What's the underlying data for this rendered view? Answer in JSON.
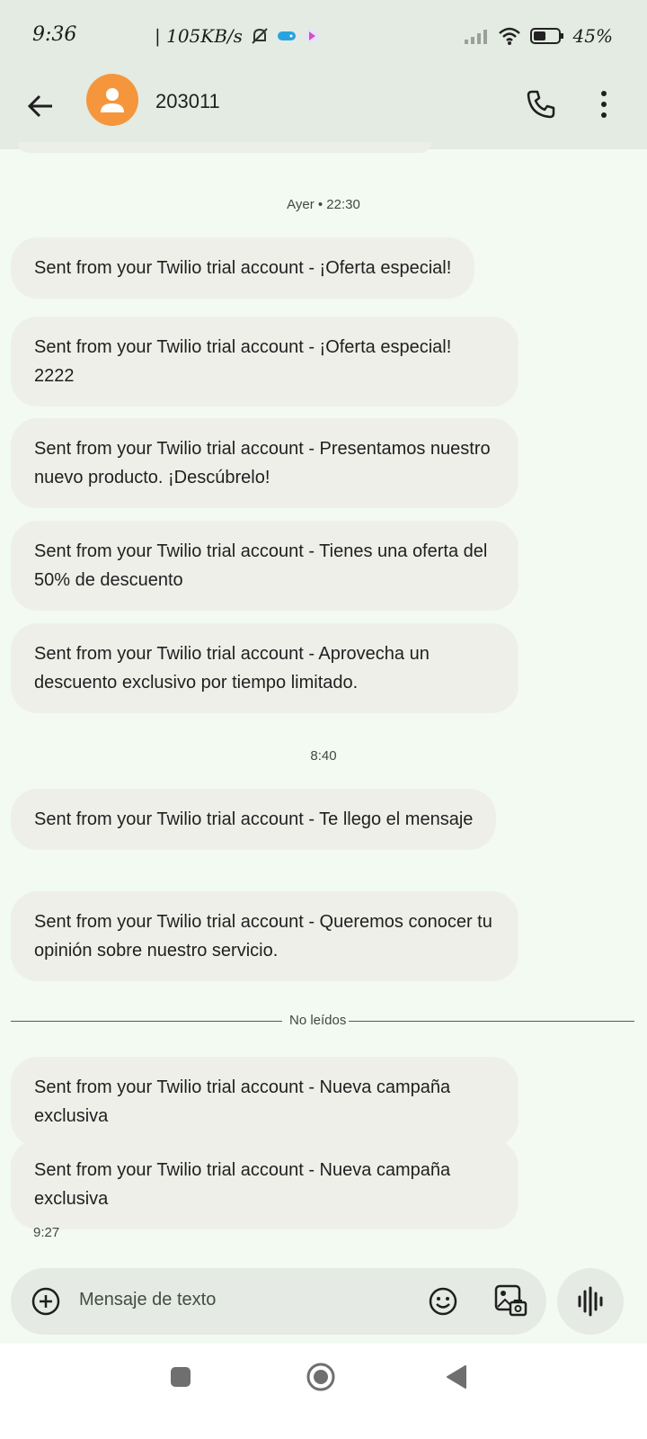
{
  "status_bar": {
    "time": "9:36",
    "network_speed": "| 105KB/s",
    "battery": "45%"
  },
  "header": {
    "contact_name": "203011"
  },
  "conversation": {
    "timestamp_1": "Ayer • 22:30",
    "messages_group_1": [
      "Sent from your Twilio trial account - ¡Oferta especial!",
      "Sent from your Twilio trial account - ¡Oferta especial! 2222",
      "Sent from your Twilio trial account - Presentamos nuestro nuevo producto. ¡Descúbrelo!",
      "Sent from your Twilio trial account - Tienes una oferta del 50% de descuento",
      "Sent from your Twilio trial account - Aprovecha un descuento exclusivo por tiempo limitado."
    ],
    "timestamp_2": "8:40",
    "messages_group_2": [
      "Sent from your Twilio trial account - Te llego el mensaje",
      "Sent from your Twilio trial account - Queremos conocer tu opinión sobre nuestro servicio."
    ],
    "unread_label": "No leídos",
    "messages_unread": [
      "Sent from your Twilio trial account - Nueva campaña exclusiva",
      "Sent from your Twilio trial account - Nueva campaña exclusiva"
    ],
    "last_message_time": "9:27"
  },
  "composer": {
    "placeholder": "Mensaje de texto"
  },
  "icons": {
    "back": "arrow-left-icon",
    "call": "phone-icon",
    "more": "more-vertical-icon",
    "add": "plus-circle-icon",
    "emoji": "emoji-icon",
    "gallery": "gallery-icon",
    "voice": "waveform-icon"
  },
  "colors": {
    "avatar": "#f6963c",
    "background": "#f2faf2",
    "header": "#e3ebe3",
    "bubble": "#efefea"
  }
}
